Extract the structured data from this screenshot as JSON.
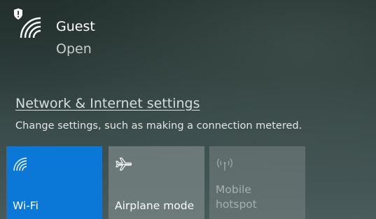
{
  "network": {
    "name": "Guest",
    "status": "Open"
  },
  "settings": {
    "link_text": "Network & Internet settings",
    "description": "Change settings, such as making a connection metered."
  },
  "quick_actions": [
    {
      "label": "Wi-Fi",
      "icon": "wifi-icon",
      "active": true
    },
    {
      "label": "Airplane mode",
      "icon": "airplane-icon",
      "active": false
    },
    {
      "label_line1": "Mobile",
      "label_line2": "hotspot",
      "icon": "hotspot-icon",
      "active": false,
      "disabled": true
    }
  ],
  "colors": {
    "accent": "#0b78d7"
  }
}
